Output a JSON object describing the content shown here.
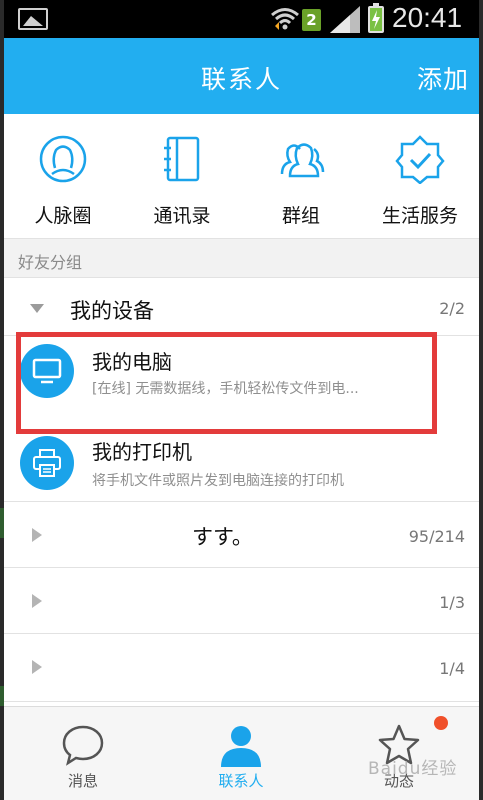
{
  "status_bar": {
    "sim_slot": "2",
    "time": "20:41"
  },
  "header": {
    "title": "联系人",
    "add_label": "添加"
  },
  "features": [
    {
      "icon": "person-circle-icon",
      "label": "人脉圈"
    },
    {
      "icon": "address-book-icon",
      "label": "通讯录"
    },
    {
      "icon": "group-icon",
      "label": "群组"
    },
    {
      "icon": "badge-check-icon",
      "label": "生活服务"
    }
  ],
  "friend_groups_header": "好友分组",
  "groups": [
    {
      "name": "我的设备",
      "count": "2/2",
      "expanded": true,
      "devices": [
        {
          "icon": "monitor-icon",
          "name": "我的电脑",
          "description": "[在线] 无需数据线，手机轻松传文件到电..."
        },
        {
          "icon": "printer-icon",
          "name": "我的打印机",
          "description": "将手机文件或照片发到电脑连接的打印机"
        }
      ]
    },
    {
      "name": "すす。",
      "count": "95/214",
      "expanded": false
    },
    {
      "name": "",
      "count": "1/3",
      "expanded": false
    },
    {
      "name": "",
      "count": "1/4",
      "expanded": false
    }
  ],
  "bottom_nav": [
    {
      "icon": "chat-bubble-icon",
      "label": "消息",
      "active": false
    },
    {
      "icon": "contact-person-icon",
      "label": "联系人",
      "active": true
    },
    {
      "icon": "star-icon",
      "label": "动态",
      "active": false
    }
  ],
  "watermark": "Baidu经验",
  "colors": {
    "header": "#22aef0",
    "accent": "#1aa3ea",
    "highlight": "#e33b3b",
    "notification": "#f0502a"
  }
}
